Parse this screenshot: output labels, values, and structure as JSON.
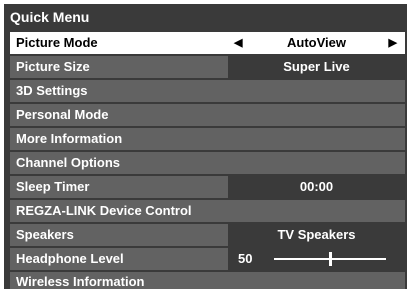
{
  "title": "Quick Menu",
  "rows": [
    {
      "label": "Picture Mode",
      "value": "AutoView"
    },
    {
      "label": "Picture Size",
      "value": "Super Live"
    },
    {
      "label": "3D Settings"
    },
    {
      "label": "Personal Mode"
    },
    {
      "label": "More Information"
    },
    {
      "label": "Channel Options"
    },
    {
      "label": "Sleep Timer",
      "value": "00:00"
    },
    {
      "label": "REGZA-LINK Device Control"
    },
    {
      "label": "Speakers",
      "value": "TV Speakers"
    },
    {
      "label": "Headphone Level",
      "value": "50",
      "level_fraction": 0.5
    },
    {
      "label": "Wireless Information"
    }
  ],
  "icons": {
    "left": "◀",
    "right": "▶"
  },
  "colors": {
    "panel": "#3a3a3a",
    "row": "#626262",
    "selected": "#ffffff"
  }
}
